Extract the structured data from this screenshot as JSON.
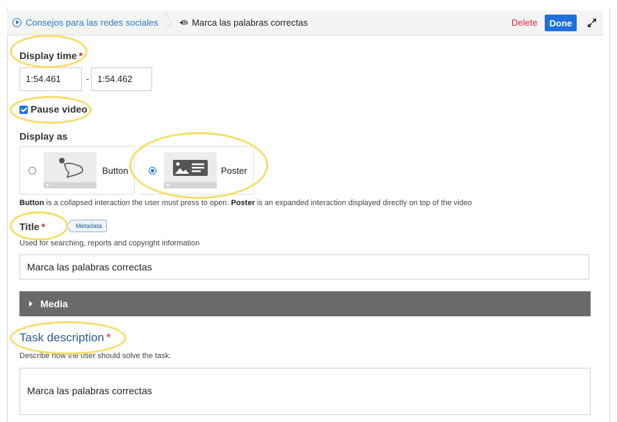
{
  "topbar": {
    "breadcrumb_root": "Consejos para las redes sociales",
    "breadcrumb_current": "Marca las palabras correctas",
    "delete_label": "Delete",
    "done_label": "Done"
  },
  "display_time": {
    "label": "Display time",
    "required_mark": "*",
    "from": "1:54.461",
    "separator": "-",
    "to": "1:54.462"
  },
  "pause_video": {
    "label": "Pause video",
    "checked": true
  },
  "display_as": {
    "label": "Display as",
    "options": [
      {
        "label": "Button",
        "selected": false
      },
      {
        "label": "Poster",
        "selected": true
      }
    ],
    "help_term1": "Button",
    "help_text1": " is a collapsed interaction the user must press to open. ",
    "help_term2": "Poster",
    "help_text2": " is an expanded interaction displayed directly on top of the video"
  },
  "title": {
    "label": "Title",
    "required_mark": "*",
    "badge": "Metadata",
    "help": "Used for searching, reports and copyright information",
    "value": "Marca las palabras correctas"
  },
  "media": {
    "label": "Media"
  },
  "task_description": {
    "label": "Task description",
    "required_mark": "*",
    "help": "Describe how the user should solve the task.",
    "value": "Marca las palabras correctas"
  },
  "colors": {
    "accent_blue": "#1f6fdc",
    "delete_red": "#e0273a",
    "highlight_yellow": "#f4df6a",
    "media_bar": "#6b6a6a"
  }
}
